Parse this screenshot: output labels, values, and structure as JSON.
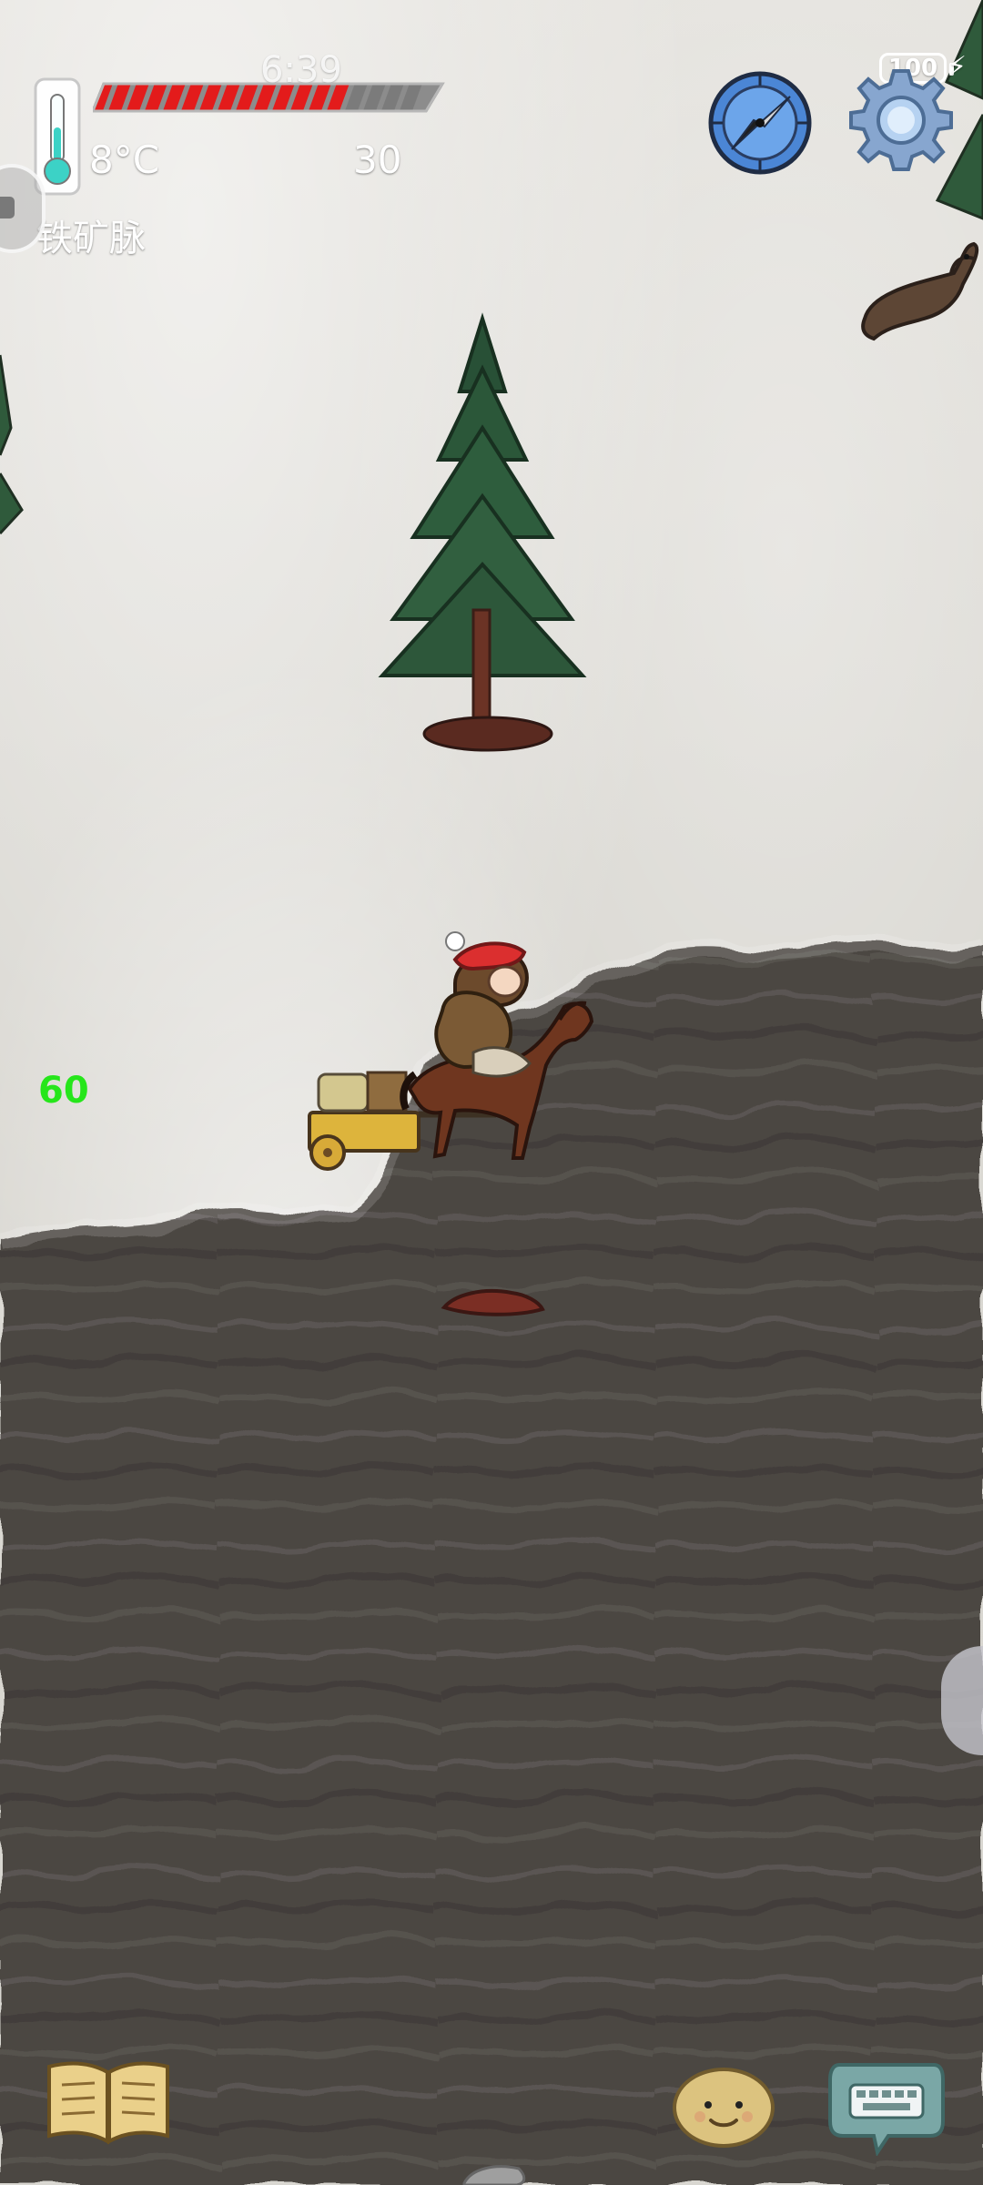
{
  "status_bar": {
    "time": "6:39",
    "battery": "100"
  },
  "hud": {
    "temperature": "8°C",
    "health_value": "30",
    "location": "铁矿脉",
    "fps": "60",
    "health_fill": 0.75
  },
  "icons": {
    "thermometer": "thermometer-icon",
    "map": "map-icon",
    "compass": "compass-icon",
    "settings": "gear-icon",
    "journal": "journal-icon",
    "emote": "face-icon",
    "keyboard": "keyboard-icon",
    "paw": "paw-icon"
  },
  "colors": {
    "health_red": "#e31b1b",
    "health_gray": "#7b7b7b",
    "fps_green": "#26e61b",
    "compass_blue": "#4d87d6",
    "journal_gold": "#d8c17a",
    "keyboard_teal": "#7ea7a6",
    "emote_tan": "#d9bf7f",
    "ground_dark": "#4b4642"
  }
}
